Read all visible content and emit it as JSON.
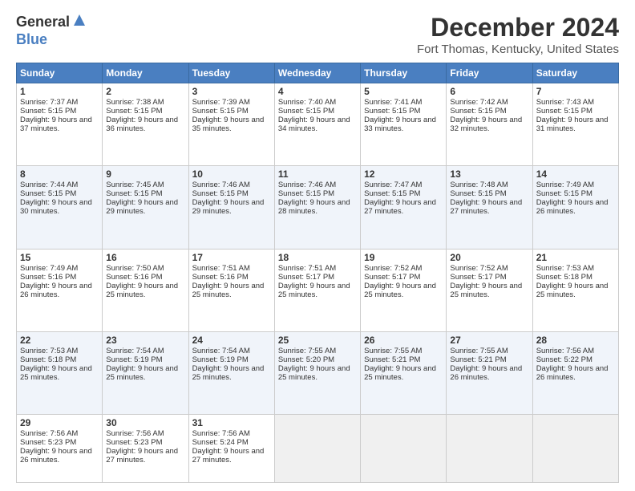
{
  "logo": {
    "general": "General",
    "blue": "Blue"
  },
  "header": {
    "month": "December 2024",
    "location": "Fort Thomas, Kentucky, United States"
  },
  "days": [
    "Sunday",
    "Monday",
    "Tuesday",
    "Wednesday",
    "Thursday",
    "Friday",
    "Saturday"
  ],
  "weeks": [
    [
      {
        "day": "1",
        "sunrise": "7:37 AM",
        "sunset": "5:15 PM",
        "daylight": "9 hours and 37 minutes."
      },
      {
        "day": "2",
        "sunrise": "7:38 AM",
        "sunset": "5:15 PM",
        "daylight": "9 hours and 36 minutes."
      },
      {
        "day": "3",
        "sunrise": "7:39 AM",
        "sunset": "5:15 PM",
        "daylight": "9 hours and 35 minutes."
      },
      {
        "day": "4",
        "sunrise": "7:40 AM",
        "sunset": "5:15 PM",
        "daylight": "9 hours and 34 minutes."
      },
      {
        "day": "5",
        "sunrise": "7:41 AM",
        "sunset": "5:15 PM",
        "daylight": "9 hours and 33 minutes."
      },
      {
        "day": "6",
        "sunrise": "7:42 AM",
        "sunset": "5:15 PM",
        "daylight": "9 hours and 32 minutes."
      },
      {
        "day": "7",
        "sunrise": "7:43 AM",
        "sunset": "5:15 PM",
        "daylight": "9 hours and 31 minutes."
      }
    ],
    [
      {
        "day": "8",
        "sunrise": "7:44 AM",
        "sunset": "5:15 PM",
        "daylight": "9 hours and 30 minutes."
      },
      {
        "day": "9",
        "sunrise": "7:45 AM",
        "sunset": "5:15 PM",
        "daylight": "9 hours and 29 minutes."
      },
      {
        "day": "10",
        "sunrise": "7:46 AM",
        "sunset": "5:15 PM",
        "daylight": "9 hours and 29 minutes."
      },
      {
        "day": "11",
        "sunrise": "7:46 AM",
        "sunset": "5:15 PM",
        "daylight": "9 hours and 28 minutes."
      },
      {
        "day": "12",
        "sunrise": "7:47 AM",
        "sunset": "5:15 PM",
        "daylight": "9 hours and 27 minutes."
      },
      {
        "day": "13",
        "sunrise": "7:48 AM",
        "sunset": "5:15 PM",
        "daylight": "9 hours and 27 minutes."
      },
      {
        "day": "14",
        "sunrise": "7:49 AM",
        "sunset": "5:15 PM",
        "daylight": "9 hours and 26 minutes."
      }
    ],
    [
      {
        "day": "15",
        "sunrise": "7:49 AM",
        "sunset": "5:16 PM",
        "daylight": "9 hours and 26 minutes."
      },
      {
        "day": "16",
        "sunrise": "7:50 AM",
        "sunset": "5:16 PM",
        "daylight": "9 hours and 25 minutes."
      },
      {
        "day": "17",
        "sunrise": "7:51 AM",
        "sunset": "5:16 PM",
        "daylight": "9 hours and 25 minutes."
      },
      {
        "day": "18",
        "sunrise": "7:51 AM",
        "sunset": "5:17 PM",
        "daylight": "9 hours and 25 minutes."
      },
      {
        "day": "19",
        "sunrise": "7:52 AM",
        "sunset": "5:17 PM",
        "daylight": "9 hours and 25 minutes."
      },
      {
        "day": "20",
        "sunrise": "7:52 AM",
        "sunset": "5:17 PM",
        "daylight": "9 hours and 25 minutes."
      },
      {
        "day": "21",
        "sunrise": "7:53 AM",
        "sunset": "5:18 PM",
        "daylight": "9 hours and 25 minutes."
      }
    ],
    [
      {
        "day": "22",
        "sunrise": "7:53 AM",
        "sunset": "5:18 PM",
        "daylight": "9 hours and 25 minutes."
      },
      {
        "day": "23",
        "sunrise": "7:54 AM",
        "sunset": "5:19 PM",
        "daylight": "9 hours and 25 minutes."
      },
      {
        "day": "24",
        "sunrise": "7:54 AM",
        "sunset": "5:19 PM",
        "daylight": "9 hours and 25 minutes."
      },
      {
        "day": "25",
        "sunrise": "7:55 AM",
        "sunset": "5:20 PM",
        "daylight": "9 hours and 25 minutes."
      },
      {
        "day": "26",
        "sunrise": "7:55 AM",
        "sunset": "5:21 PM",
        "daylight": "9 hours and 25 minutes."
      },
      {
        "day": "27",
        "sunrise": "7:55 AM",
        "sunset": "5:21 PM",
        "daylight": "9 hours and 26 minutes."
      },
      {
        "day": "28",
        "sunrise": "7:56 AM",
        "sunset": "5:22 PM",
        "daylight": "9 hours and 26 minutes."
      }
    ],
    [
      {
        "day": "29",
        "sunrise": "7:56 AM",
        "sunset": "5:23 PM",
        "daylight": "9 hours and 26 minutes."
      },
      {
        "day": "30",
        "sunrise": "7:56 AM",
        "sunset": "5:23 PM",
        "daylight": "9 hours and 27 minutes."
      },
      {
        "day": "31",
        "sunrise": "7:56 AM",
        "sunset": "5:24 PM",
        "daylight": "9 hours and 27 minutes."
      },
      null,
      null,
      null,
      null
    ]
  ]
}
